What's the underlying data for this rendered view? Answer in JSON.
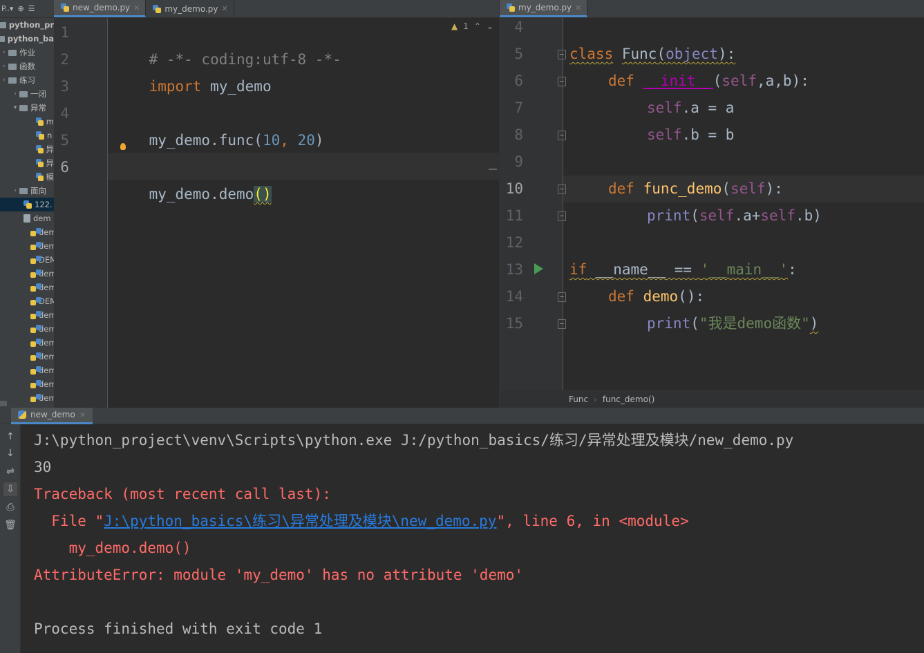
{
  "sidebar": {
    "toolbar_label": "P..▾",
    "items": [
      {
        "label": "python_pr",
        "kind": "folder-bold"
      },
      {
        "label": "python_ba",
        "kind": "folder-bold"
      },
      {
        "label": "作业",
        "kind": "folder"
      },
      {
        "label": "函数",
        "kind": "folder"
      },
      {
        "label": "练习",
        "kind": "folder"
      },
      {
        "label": "一闭",
        "kind": "subfolder"
      },
      {
        "label": "异常",
        "kind": "subfolder-open"
      },
      {
        "label": "m",
        "kind": "py"
      },
      {
        "label": "n",
        "kind": "py"
      },
      {
        "label": "异",
        "kind": "py"
      },
      {
        "label": "异",
        "kind": "py"
      },
      {
        "label": "模",
        "kind": "py"
      },
      {
        "label": "面向",
        "kind": "subfolder"
      },
      {
        "label": "122.",
        "kind": "py-selected"
      },
      {
        "label": "dem",
        "kind": "txt"
      },
      {
        "label": "dem",
        "kind": "py"
      },
      {
        "label": "dem",
        "kind": "py"
      },
      {
        "label": "DEM",
        "kind": "py"
      },
      {
        "label": "dem",
        "kind": "py"
      },
      {
        "label": "dem",
        "kind": "py"
      },
      {
        "label": "DEM",
        "kind": "py"
      },
      {
        "label": "dem",
        "kind": "py"
      },
      {
        "label": "dem",
        "kind": "py"
      },
      {
        "label": "dem",
        "kind": "py"
      },
      {
        "label": "dem",
        "kind": "py"
      },
      {
        "label": "dem",
        "kind": "py"
      },
      {
        "label": "dem",
        "kind": "py"
      },
      {
        "label": "dem",
        "kind": "py"
      }
    ]
  },
  "left_editor": {
    "tabs": [
      {
        "label": "new_demo.py",
        "active": true
      },
      {
        "label": "my_demo.py",
        "active": false
      }
    ],
    "inspection": {
      "warnings": "1",
      "up": "^",
      "down": "v"
    },
    "line_numbers": [
      "1",
      "2",
      "3",
      "4",
      "5",
      "6"
    ],
    "lines": {
      "l1": "# -*- coding:utf-8 -*-",
      "l2_kw": "import",
      "l2_rest": " my_demo",
      "l4_a": "my_demo.func(",
      "l4_n1": "10",
      "l4_c": ", ",
      "l4_n2": "20",
      "l4_e": ")",
      "l6_a": "my_demo.demo",
      "l6_p": "()"
    }
  },
  "right_editor": {
    "tabs": [
      {
        "label": "my_demo.py",
        "active": true
      }
    ],
    "line_numbers": [
      "4",
      "5",
      "6",
      "7",
      "8",
      "9",
      "10",
      "11",
      "12",
      "13",
      "14",
      "15"
    ],
    "code": {
      "l5_kw": "class",
      "l5_name": "Func",
      "l5_o": "(",
      "l5_base": "object",
      "l5_e": "):",
      "l6_kw": "def",
      "l6_fn": "__init__",
      "l6_o": "(",
      "l6_self": "self",
      "l6_args": ",a,b",
      "l6_e": "):",
      "l7_self": "self",
      "l7_rest": ".a = a",
      "l8_self": "self",
      "l8_rest": ".b = b",
      "l10_kw": "def",
      "l10_fn": "func_demo",
      "l10_o": "(",
      "l10_self": "self",
      "l10_e": "):",
      "l11_print": "print",
      "l11_o": "(",
      "l11_self1": "self",
      "l11_mid": ".a+",
      "l11_self2": "self",
      "l11_e": ".b)",
      "l13_kw": "if",
      "l13_name": " __name__",
      "l13_eq": " == ",
      "l13_str": "'__main__'",
      "l13_e": ":",
      "l14_kw": "def",
      "l14_fn": "demo",
      "l14_e": "():",
      "l15_print": "print",
      "l15_o": "(",
      "l15_str": "\"我是demo函数\"",
      "l15_e": ")"
    },
    "breadcrumb": [
      "Func",
      "func_demo()"
    ]
  },
  "run_panel": {
    "tab_label": "new_demo",
    "toolbar": [
      "↑",
      "↓",
      "⇌",
      "⇩",
      "⎙",
      "🗑"
    ],
    "console": {
      "line1": "J:\\python_project\\venv\\Scripts\\python.exe J:/python_basics/练习/异常处理及模块/new_demo.py",
      "line2": "30",
      "line3": "Traceback (most recent call last):",
      "line4_pre": "  File \"",
      "line4_link": "J:\\python_basics\\练习\\异常处理及模块\\new_demo.py",
      "line4_post": "\", line 6, in <module>",
      "line5": "    my_demo.demo()",
      "line6": "AttributeError: module 'my_demo' has no attribute 'demo'",
      "line8": "Process finished with exit code 1"
    }
  }
}
